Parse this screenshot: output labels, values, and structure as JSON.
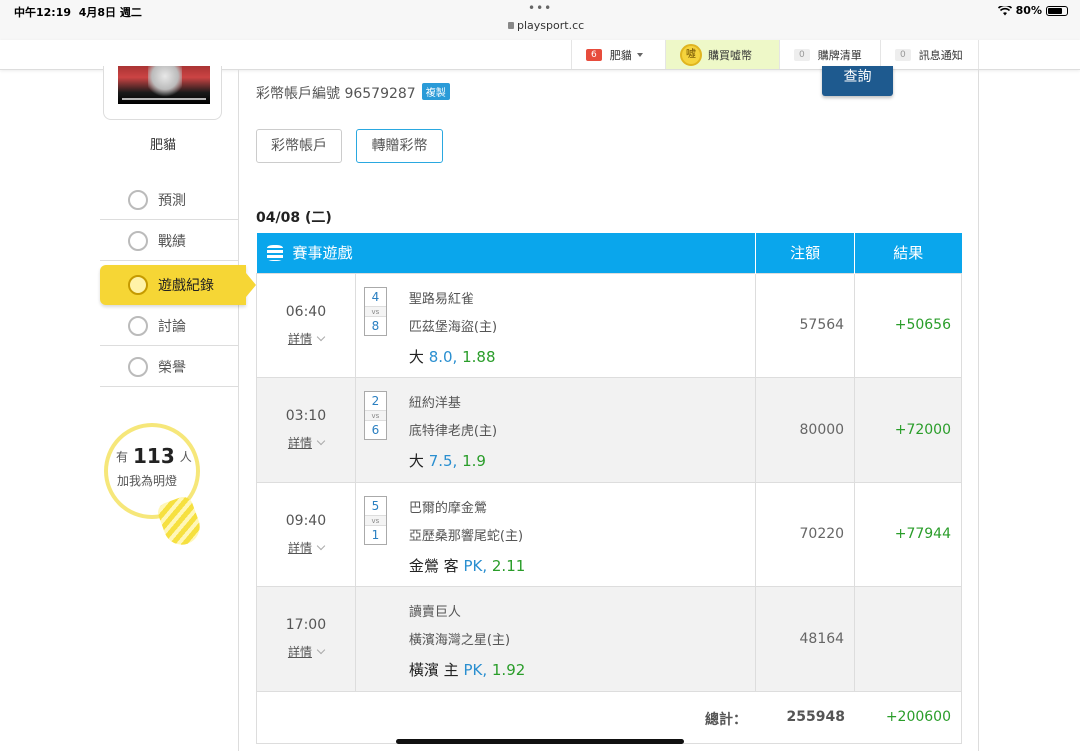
{
  "status_bar": {
    "time": "中午12:19",
    "date": "4月8日 週二",
    "url": "playsport.cc",
    "battery": "80%",
    "dots": "•••"
  },
  "top_nav": {
    "user_badge": "6",
    "user_label": "肥貓",
    "buy_coin_icon": "噓",
    "buy_label": "購買噓幣",
    "cart_badge": "0",
    "cart_label": "購牌清單",
    "notify_badge": "0",
    "notify_label": "訊息通知"
  },
  "sidebar": {
    "username": "肥貓",
    "items": [
      {
        "label": "預測",
        "icon": "target-icon"
      },
      {
        "label": "戰績",
        "icon": "record-icon"
      },
      {
        "label": "遊戲紀錄",
        "icon": "circle-icon"
      },
      {
        "label": "討論",
        "icon": "discussion-icon"
      },
      {
        "label": "榮譽",
        "icon": "medal-icon"
      }
    ],
    "lamp": {
      "prefix": "有",
      "count": "113",
      "suffix": "人",
      "line2": "加我為明燈"
    }
  },
  "main": {
    "query_button": "查詢",
    "account_label": "彩幣帳戶編號 96579287",
    "copy_label": "複製",
    "tabs": [
      "彩幣帳戶",
      "轉贈彩幣"
    ],
    "date": "04/08 (二)",
    "table": {
      "headers": {
        "game": "賽事遊戲",
        "stake": "注額",
        "result": "結果"
      },
      "details_label": "詳情",
      "rows": [
        {
          "time": "06:40",
          "score1": "4",
          "vs": "vs",
          "score2": "8",
          "team1": "聖路易紅雀",
          "team2": "匹茲堡海盜(主)",
          "pick_text": "大",
          "pick_line": "8.0,",
          "pick_odds": "1.88",
          "stake": "57564",
          "result": "+50656"
        },
        {
          "time": "03:10",
          "score1": "2",
          "vs": "vs",
          "score2": "6",
          "team1": "紐約洋基",
          "team2": "底特律老虎(主)",
          "pick_text": "大",
          "pick_line": "7.5,",
          "pick_odds": "1.9",
          "stake": "80000",
          "result": "+72000"
        },
        {
          "time": "09:40",
          "score1": "5",
          "vs": "vs",
          "score2": "1",
          "team1": "巴爾的摩金鶯",
          "team2": "亞歷桑那響尾蛇(主)",
          "pick_text": "金鶯 客",
          "pick_line": "PK,",
          "pick_odds": "2.11",
          "stake": "70220",
          "result": "+77944"
        },
        {
          "time": "17:00",
          "score1": "",
          "vs": "",
          "score2": "",
          "team1": "讀賣巨人",
          "team2": "橫濱海灣之星(主)",
          "pick_text": "橫濱 主",
          "pick_line": "PK,",
          "pick_odds": "1.92",
          "stake": "48164",
          "result": ""
        }
      ],
      "total_label": "總計：",
      "total_stake": "255948",
      "total_result": "+200600"
    }
  },
  "colors": {
    "header_blue": "#0aa6ec",
    "active_yellow": "#f6d635",
    "win_green": "#2a9d2a",
    "line_blue": "#2a8fd0",
    "query_navy": "#1e5a8f"
  }
}
